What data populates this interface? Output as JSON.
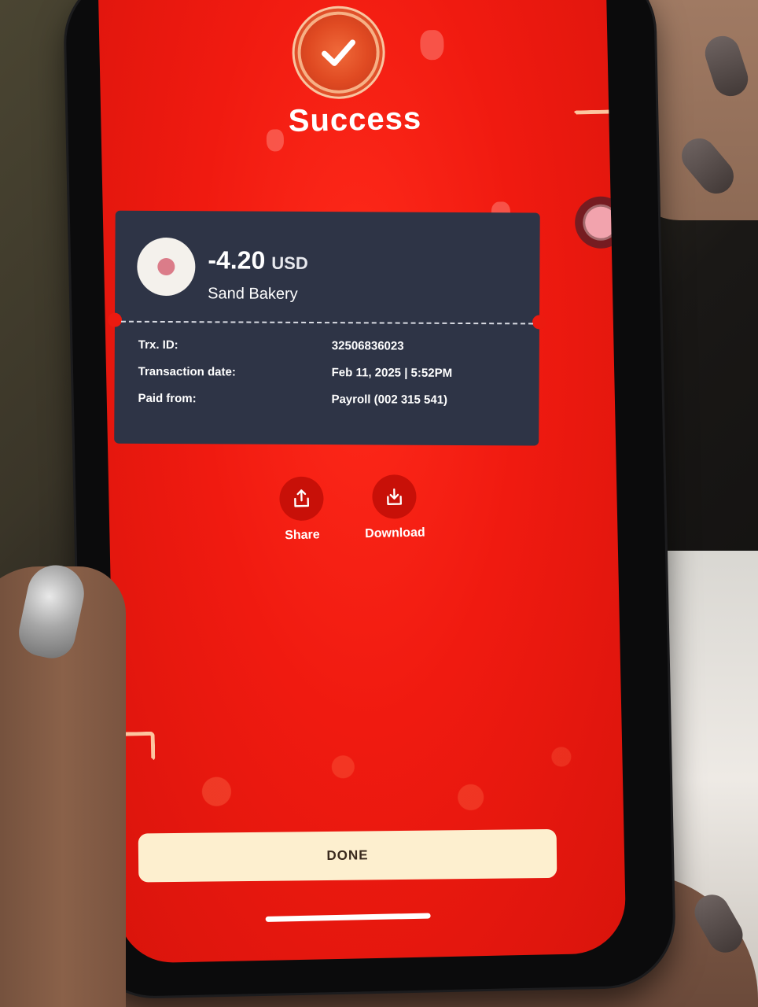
{
  "status": {
    "title": "Success"
  },
  "transaction": {
    "amount": "-4.20",
    "currency": "USD",
    "merchant": "Sand Bakery"
  },
  "details": [
    {
      "label": "Trx. ID:",
      "value": "32506836023"
    },
    {
      "label": "Transaction date:",
      "value": "Feb 11, 2025 | 5:52PM"
    },
    {
      "label": "Paid from:",
      "value": "Payroll (002 315 541)"
    }
  ],
  "actions": {
    "share_label": "Share",
    "download_label": "Download"
  },
  "done_label": "DONE",
  "colors": {
    "background_red": "#f01a10",
    "card_dark": "#2e3446",
    "done_button": "#fdefcf",
    "action_circle": "#c81008"
  },
  "icons": {
    "status": "check-icon",
    "share": "share-icon",
    "download": "download-icon"
  }
}
